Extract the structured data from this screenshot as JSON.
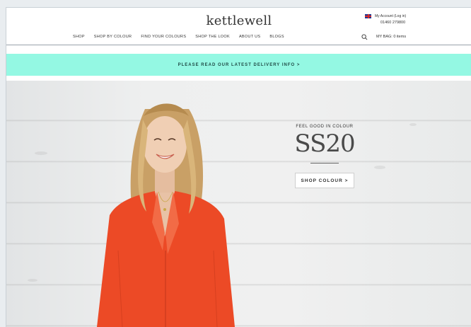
{
  "header": {
    "logo": "kettlewell",
    "nav": [
      "SHOP",
      "SHOP BY COLOUR",
      "FIND YOUR COLOURS",
      "SHOP THE LOOK",
      "ABOUT US",
      "BLOGS"
    ],
    "account_label": "My Account (Log in)",
    "phone": "01460 279800",
    "bag_label": "MY BAG: 0 items",
    "flag_icon": "uk-flag-icon",
    "search_icon": "search-icon"
  },
  "banner": {
    "text": "PLEASE READ OUR LATEST DELIVERY INFO >"
  },
  "hero": {
    "subtitle": "FEEL GOOD IN COLOUR",
    "title": "SS20",
    "button_label": "SHOP COLOUR >"
  },
  "colors": {
    "banner": "#94f8e3",
    "top_orange": "#ec4a26"
  }
}
